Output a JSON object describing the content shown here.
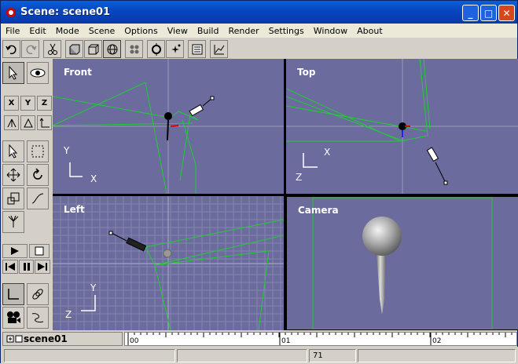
{
  "window": {
    "title": "Scene: scene01",
    "minimize": "_",
    "maximize": "□",
    "close": "✕"
  },
  "menu": [
    "File",
    "Edit",
    "Mode",
    "Scene",
    "Options",
    "View",
    "Build",
    "Render",
    "Settings",
    "Window",
    "About"
  ],
  "toolbar": {
    "icons": [
      "undo-icon",
      "redo-icon",
      "cut-icon",
      "solid-box-icon",
      "wire-box-icon",
      "sphere-icon",
      "grid-dots-icon",
      "target-icon",
      "light-icon",
      "list-icon",
      "graph-icon"
    ]
  },
  "leftbar": {
    "axes": [
      "X",
      "Y",
      "Z"
    ],
    "tools": [
      "select-icon",
      "eye-icon",
      "move-icon",
      "rotate-icon",
      "scale-icon",
      "curve-icon",
      "bones-icon",
      "play-icon",
      "stop-icon",
      "prev-icon",
      "pause-icon",
      "next-icon"
    ]
  },
  "viewports": {
    "front": {
      "label": "Front",
      "axis_y": "Y",
      "axis_x": "X"
    },
    "top": {
      "label": "Top",
      "axis_x": "X",
      "axis_z": "Z"
    },
    "left": {
      "label": "Left",
      "axis_y": "Y",
      "axis_z": "Z"
    },
    "camera": {
      "label": "Camera"
    }
  },
  "timeline": {
    "scene_name": "scene01",
    "ticks": [
      "00",
      "01",
      "02"
    ]
  },
  "status": {
    "frame": "71"
  },
  "colors": {
    "viewport_bg": "#6b6b9e",
    "wire": "#22cc33",
    "title_bar": "#0a5fd8"
  }
}
